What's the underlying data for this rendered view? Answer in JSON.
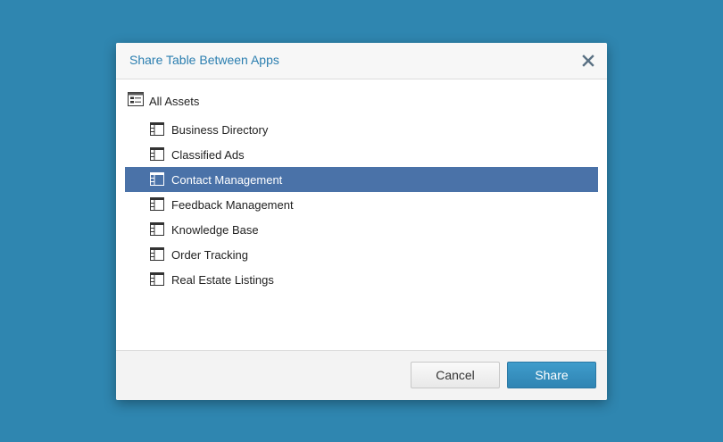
{
  "dialog": {
    "title": "Share Table Between Apps",
    "close_icon": "close-icon"
  },
  "tree": {
    "root": {
      "label": "All Assets",
      "icon": "folder-tree-icon"
    },
    "items": [
      {
        "label": "Business Directory",
        "icon": "table-icon",
        "selected": false
      },
      {
        "label": "Classified Ads",
        "icon": "table-icon",
        "selected": false
      },
      {
        "label": "Contact Management",
        "icon": "table-icon",
        "selected": true
      },
      {
        "label": "Feedback Management",
        "icon": "table-icon",
        "selected": false
      },
      {
        "label": "Knowledge Base",
        "icon": "table-icon",
        "selected": false
      },
      {
        "label": "Order Tracking",
        "icon": "table-icon",
        "selected": false
      },
      {
        "label": "Real Estate Listings",
        "icon": "table-icon",
        "selected": false
      }
    ]
  },
  "footer": {
    "cancel_label": "Cancel",
    "share_label": "Share"
  },
  "colors": {
    "background": "#2f86b0",
    "title": "#2c7fb0",
    "selection": "#4a72a8",
    "primary_button": "#3790c0"
  }
}
